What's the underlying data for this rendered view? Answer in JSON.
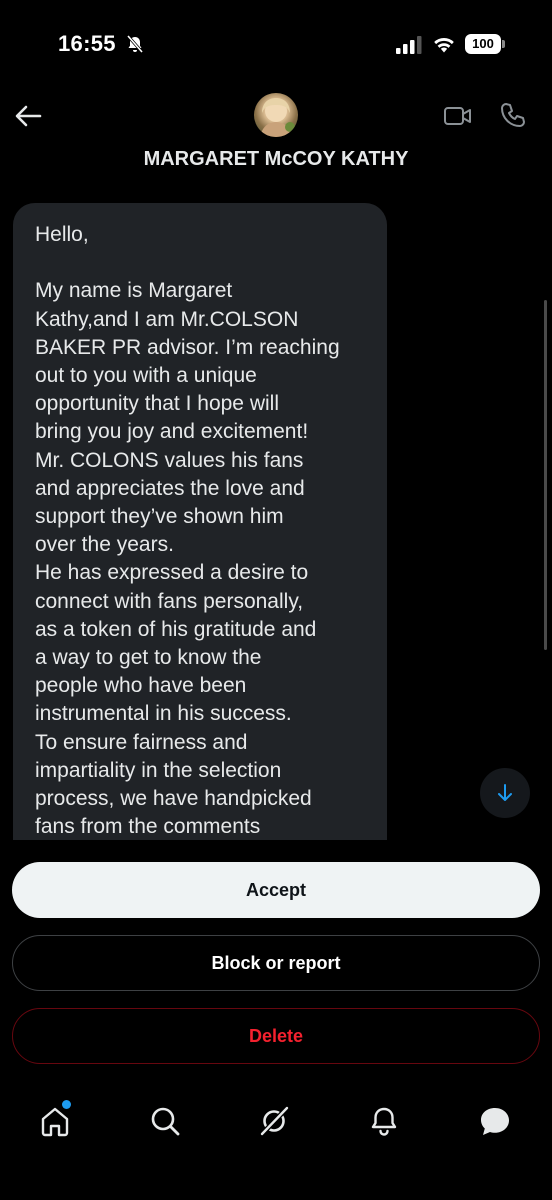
{
  "status_bar": {
    "time": "16:55",
    "battery": "100"
  },
  "header": {
    "contact_name": "MARGARET McCOY KATHY"
  },
  "message": {
    "text": "Hello,\n\nMy name is Margaret\nKathy,and I am Mr.COLSON\nBAKER PR advisor. I’m reaching\nout to you with a unique\nopportunity that I hope will\nbring you joy and excitement!\nMr. COLONS values his fans\nand appreciates the love and\nsupport they’ve shown him\nover the years.\nHe has expressed a desire to\nconnect with fans personally,\nas a token of his gratitude and\na way to get to know the\npeople who have been\ninstrumental in his success.\nTo ensure fairness and\nimpartiality in the selection\nprocess, we have handpicked\nfans from the comments"
  },
  "actions": {
    "accept_label": "Accept",
    "block_label": "Block or report",
    "delete_label": "Delete"
  },
  "colors": {
    "background": "#000000",
    "bubble": "#202327",
    "accent_blue": "#1d9bf0",
    "delete_red": "#f4212e"
  },
  "icons": {
    "back": "back-arrow-icon",
    "video": "video-call-icon",
    "phone": "phone-call-icon",
    "scroll_down": "arrow-down-icon",
    "nav": [
      "home-icon",
      "search-icon",
      "grok-icon",
      "notifications-bell-icon",
      "messages-icon"
    ]
  }
}
